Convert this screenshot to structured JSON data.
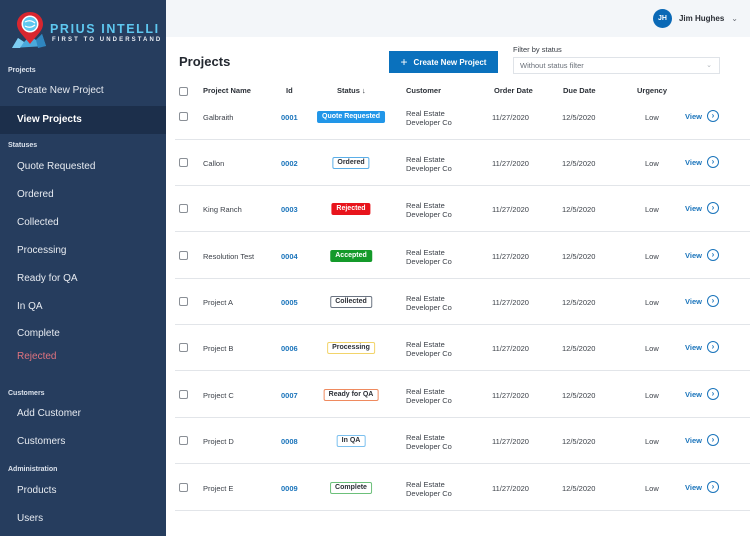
{
  "brand": {
    "name": "PRIUS INTELLI",
    "tagline": "FIRST TO UNDERSTAND"
  },
  "sidebar": {
    "sections": [
      {
        "label": "Projects",
        "items": [
          {
            "label": "Create New Project",
            "active": false
          },
          {
            "label": "View Projects",
            "active": true
          }
        ]
      },
      {
        "label": "Statuses",
        "items": [
          {
            "label": "Quote Requested"
          },
          {
            "label": "Ordered"
          },
          {
            "label": "Collected"
          },
          {
            "label": "Processing"
          },
          {
            "label": "Ready for QA"
          },
          {
            "label": "In QA"
          },
          {
            "label": "Complete"
          },
          {
            "label": "Rejected",
            "color": "#e0737f"
          }
        ]
      },
      {
        "label": "Customers",
        "items": [
          {
            "label": "Add Customer"
          },
          {
            "label": "Customers"
          }
        ]
      },
      {
        "label": "Administration",
        "items": [
          {
            "label": "Products"
          },
          {
            "label": "Users"
          }
        ]
      }
    ]
  },
  "user": {
    "initials": "JH",
    "name": "Jim Hughes",
    "avatar_color": "#0a69b6"
  },
  "main": {
    "title": "Projects",
    "create_button": {
      "icon": "plus-icon",
      "label": "Create New Project"
    },
    "filter": {
      "label": "Filter by status",
      "selected": "Without status filter"
    }
  },
  "table": {
    "columns": [
      "Project Name",
      "Id",
      "Status",
      "Customer",
      "Order Date",
      "Due Date",
      "Urgency"
    ],
    "sort_indicator": "↓",
    "view_label": "View",
    "rows": [
      {
        "name": "Galbraith",
        "id": "0001",
        "status": "Quote Requested",
        "customer": [
          "Real Estate",
          "Developer Co"
        ],
        "order_date": "11/27/2020",
        "due_date": "12/5/2020",
        "urgency": "Low"
      },
      {
        "name": "Callon",
        "id": "0002",
        "status": "Ordered",
        "customer": [
          "Real Estate",
          "Developer Co"
        ],
        "order_date": "11/27/2020",
        "due_date": "12/5/2020",
        "urgency": "Low"
      },
      {
        "name": "King Ranch",
        "id": "0003",
        "status": "Rejected",
        "customer": [
          "Real Estate",
          "Developer Co"
        ],
        "order_date": "11/27/2020",
        "due_date": "12/5/2020",
        "urgency": "Low"
      },
      {
        "name": "Resolution Test",
        "id": "0004",
        "status": "Accepted",
        "customer": [
          "Real Estate",
          "Developer Co"
        ],
        "order_date": "11/27/2020",
        "due_date": "12/5/2020",
        "urgency": "Low"
      },
      {
        "name": "Project A",
        "id": "0005",
        "status": "Collected",
        "customer": [
          "Real Estate",
          "Developer Co"
        ],
        "order_date": "11/27/2020",
        "due_date": "12/5/2020",
        "urgency": "Low"
      },
      {
        "name": "Project B",
        "id": "0006",
        "status": "Processing",
        "customer": [
          "Real Estate",
          "Developer Co"
        ],
        "order_date": "11/27/2020",
        "due_date": "12/5/2020",
        "urgency": "Low"
      },
      {
        "name": "Project C",
        "id": "0007",
        "status": "Ready for QA",
        "customer": [
          "Real Estate",
          "Developer Co"
        ],
        "order_date": "11/27/2020",
        "due_date": "12/5/2020",
        "urgency": "Low"
      },
      {
        "name": "Project D",
        "id": "0008",
        "status": "In QA",
        "customer": [
          "Real Estate",
          "Developer Co"
        ],
        "order_date": "11/27/2020",
        "due_date": "12/5/2020",
        "urgency": "Low"
      },
      {
        "name": "Project E",
        "id": "0009",
        "status": "Complete",
        "customer": [
          "Real Estate",
          "Developer Co"
        ],
        "order_date": "11/27/2020",
        "due_date": "12/5/2020",
        "urgency": "Low"
      }
    ]
  },
  "status_styles": {
    "Quote Requested": {
      "bg": "#2196e8",
      "fg": "#ffffff",
      "border": "#2196e8"
    },
    "Ordered": {
      "bg": "#ffffff",
      "fg": "#2b2f36",
      "border": "#5aaee8"
    },
    "Rejected": {
      "bg": "#e8141c",
      "fg": "#ffffff",
      "border": "#e8141c"
    },
    "Accepted": {
      "bg": "#149a2a",
      "fg": "#ffffff",
      "border": "#149a2a"
    },
    "Collected": {
      "bg": "#ffffff",
      "fg": "#2b2f36",
      "border": "#6b7482"
    },
    "Processing": {
      "bg": "#ffffff",
      "fg": "#2b2f36",
      "border": "#f2d46a"
    },
    "Ready for QA": {
      "bg": "#ffffff",
      "fg": "#2b2f36",
      "border": "#ef8a5f"
    },
    "In QA": {
      "bg": "#ffffff",
      "fg": "#2b2f36",
      "border": "#7cc0ee"
    },
    "Complete": {
      "bg": "#ffffff",
      "fg": "#2b2f36",
      "border": "#6cc07a"
    }
  }
}
